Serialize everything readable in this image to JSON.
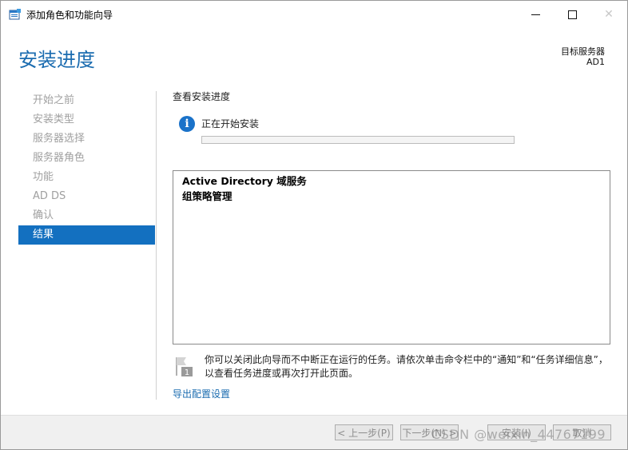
{
  "window": {
    "title": "添加角色和功能向导",
    "close_glyph": "✕"
  },
  "header": {
    "page_title": "安装进度",
    "target_server_label": "目标服务器",
    "target_server_name": "AD1"
  },
  "nav": {
    "items": [
      {
        "label": "开始之前",
        "active": false
      },
      {
        "label": "安装类型",
        "active": false
      },
      {
        "label": "服务器选择",
        "active": false
      },
      {
        "label": "服务器角色",
        "active": false
      },
      {
        "label": "功能",
        "active": false
      },
      {
        "label": "AD DS",
        "active": false
      },
      {
        "label": "确认",
        "active": false
      },
      {
        "label": "结果",
        "active": true
      }
    ]
  },
  "main": {
    "section_label": "查看安装进度",
    "status_text": "正在开始安装",
    "progress_fraction": 0,
    "results": [
      "Active Directory 域服务",
      "组策略管理"
    ],
    "note": "你可以关闭此向导而不中断正在运行的任务。请依次单击命令栏中的“通知”和“任务详细信息”，以查看任务进度或再次打开此页面。",
    "export_link": "导出配置设置"
  },
  "footer": {
    "prev_label": "< 上一步(P)",
    "next_label": "下一步(N) >",
    "install_label": "安装(I)",
    "cancel_label": "取消"
  },
  "watermark": "CSDN @weixin_44767199",
  "colors": {
    "accent": "#1b6cb0",
    "nav_active": "#1370c0",
    "info_icon": "#1a72c9"
  }
}
